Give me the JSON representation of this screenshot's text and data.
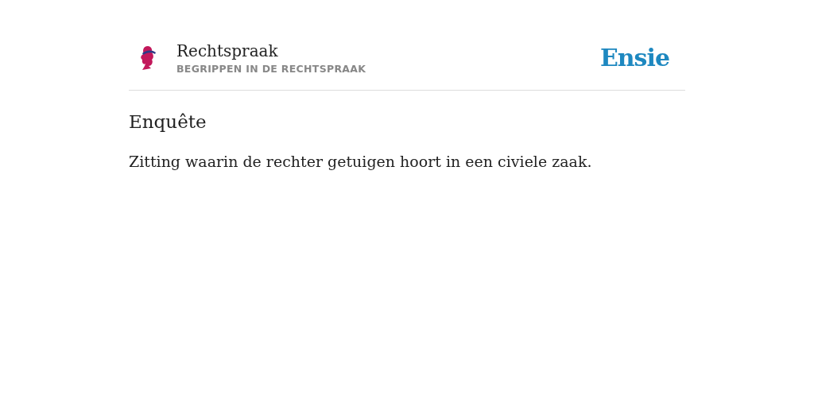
{
  "header": {
    "title": "Rechtspraak",
    "subtitle": "BEGRIPPEN IN DE RECHTSPRAAK",
    "brand": "Ensie"
  },
  "entry": {
    "term": "Enquête",
    "definition": "Zitting waarin de rechter getuigen hoort in een civiele zaak."
  }
}
